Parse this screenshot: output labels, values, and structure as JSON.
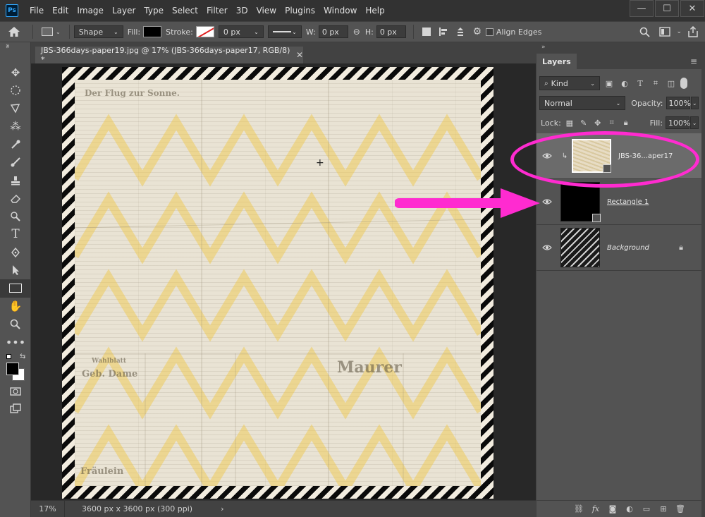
{
  "menubar": {
    "logo": "Ps",
    "items": [
      "File",
      "Edit",
      "Image",
      "Layer",
      "Type",
      "Select",
      "Filter",
      "3D",
      "View",
      "Plugins",
      "Window",
      "Help"
    ],
    "controls": {
      "minimize": "—",
      "maximize": "☐",
      "close": "✕"
    }
  },
  "options": {
    "tool_mode": "Shape",
    "fill_label": "Fill:",
    "stroke_label": "Stroke:",
    "stroke_width": "0 px",
    "w_label": "W:",
    "w_value": "0 px",
    "h_label": "H:",
    "h_value": "0 px",
    "align_edges": "Align Edges"
  },
  "document": {
    "tab_title": "JBS-366days-paper19.jpg @ 17% (JBS-366days-paper17, RGB/8) *",
    "zoom": "17%",
    "info": "3600 px x 3600 px (300 ppi)"
  },
  "canvas": {
    "headline_top": "Der Flug zur Sonne.",
    "headline_maurer": "Maurer",
    "headline_frau": "Fräulein",
    "headline_dame": "Geb. Dame",
    "headline_wahl": "Wahlblatt"
  },
  "layers": {
    "panel_title": "Layers",
    "filter_kind": "Kind",
    "blend_mode": "Normal",
    "opacity_label": "Opacity:",
    "opacity_value": "100%",
    "lock_label": "Lock:",
    "fill_label": "Fill:",
    "fill_value": "100%",
    "items": [
      {
        "name": "JBS-36...aper17",
        "visible": true,
        "clipped": true
      },
      {
        "name": "Rectangle 1",
        "visible": true
      },
      {
        "name": "Background",
        "visible": true,
        "locked": true
      }
    ]
  },
  "colors": {
    "annotation": "#ff2bd0",
    "chevron": "#f0c640"
  }
}
